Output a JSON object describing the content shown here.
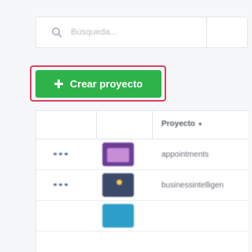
{
  "search": {
    "placeholder": "Búsqueda..."
  },
  "toolbar": {
    "create_label": "Crear proyecto"
  },
  "table": {
    "headers": {
      "project": "Proyecto"
    },
    "rows": [
      {
        "name": "appointments",
        "thumb": "calendar-thumbnail"
      },
      {
        "name": "businessintelligen",
        "thumb": "lightbulb-thumbnail"
      },
      {
        "name": "",
        "thumb": "teal-thumbnail"
      }
    ]
  },
  "colors": {
    "accent_green": "#2db34a",
    "highlight": "#e0405f",
    "link_blue": "#5b76a8"
  }
}
